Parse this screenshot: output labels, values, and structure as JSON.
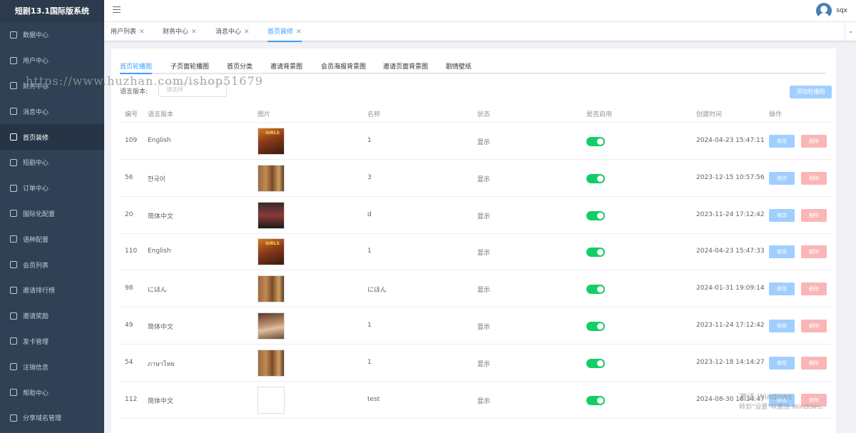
{
  "app": {
    "title": "短剧13.1国际版系统"
  },
  "sidebar": {
    "items": [
      {
        "label": "数据中心",
        "icon": "chart-icon",
        "active": false
      },
      {
        "label": "用户中心",
        "icon": "user-icon",
        "active": false
      },
      {
        "label": "财务中心",
        "icon": "wallet-icon",
        "active": false
      },
      {
        "label": "消息中心",
        "icon": "message-icon",
        "active": false
      },
      {
        "label": "首页装修",
        "icon": "cube-icon",
        "active": true
      },
      {
        "label": "短剧中心",
        "icon": "film-icon",
        "active": false
      },
      {
        "label": "订单中心",
        "icon": "order-icon",
        "active": false
      },
      {
        "label": "国际化配置",
        "icon": "globe-icon",
        "active": false
      },
      {
        "label": "语种配置",
        "icon": "language-icon",
        "active": false
      },
      {
        "label": "会员列表",
        "icon": "list-icon",
        "active": false
      },
      {
        "label": "邀请排行榜",
        "icon": "bar-chart-icon",
        "active": false
      },
      {
        "label": "邀请奖励",
        "icon": "gift-icon",
        "active": false
      },
      {
        "label": "发卡管理",
        "icon": "card-icon",
        "active": false
      },
      {
        "label": "注销信息",
        "icon": "logout-icon",
        "active": false
      },
      {
        "label": "帮助中心",
        "icon": "help-icon",
        "active": false
      },
      {
        "label": "分享域名管理",
        "icon": "share-icon",
        "active": false
      }
    ]
  },
  "header": {
    "username": "sqx"
  },
  "tags": [
    {
      "label": "用户列表",
      "active": false
    },
    {
      "label": "财务中心",
      "active": false
    },
    {
      "label": "消息中心",
      "active": false
    },
    {
      "label": "首页装修",
      "active": true
    }
  ],
  "tabs": [
    "首页轮播图",
    "子页面轮播图",
    "首页分类",
    "邀请背景图",
    "会员海报背景图",
    "邀请页面背景图",
    "剧情壁纸"
  ],
  "filter": {
    "label": "语言版本:",
    "placeholder": "请选择"
  },
  "add_button": "添加轮播图",
  "table": {
    "headers": [
      "编号",
      "语言版本",
      "图片",
      "名称",
      "状态",
      "是否启用",
      "创建时间",
      "操作"
    ],
    "edit_label": "修改",
    "delete_label": "删除",
    "rows": [
      {
        "id": "109",
        "lang": "English",
        "name": "1",
        "status": "显示",
        "created": "2024-04-23 15:47:11",
        "thumb": "t1",
        "thumb_text": "GIRLS",
        "enabled": true
      },
      {
        "id": "56",
        "lang": "한국어",
        "name": "3",
        "status": "显示",
        "created": "2023-12-15 10:57:56",
        "thumb": "t2",
        "thumb_text": "",
        "enabled": true
      },
      {
        "id": "20",
        "lang": "简体中文",
        "name": "d",
        "status": "显示",
        "created": "2023-11-24 17:12:42",
        "thumb": "t3",
        "thumb_text": "",
        "enabled": true
      },
      {
        "id": "110",
        "lang": "English",
        "name": "1",
        "status": "显示",
        "created": "2024-04-23 15:47:33",
        "thumb": "t1",
        "thumb_text": "GIRLS",
        "enabled": true
      },
      {
        "id": "98",
        "lang": "にほん",
        "name": "にほん",
        "status": "显示",
        "created": "2024-01-31 19:09:14",
        "thumb": "t2",
        "thumb_text": "",
        "enabled": true
      },
      {
        "id": "49",
        "lang": "简体中文",
        "name": "1",
        "status": "显示",
        "created": "2023-11-24 17:12:42",
        "thumb": "t4",
        "thumb_text": "",
        "enabled": true
      },
      {
        "id": "54",
        "lang": "ภาษาไทย",
        "name": "1",
        "status": "显示",
        "created": "2023-12-18 14:14:27",
        "thumb": "t2",
        "thumb_text": "",
        "enabled": true
      },
      {
        "id": "112",
        "lang": "简体中文",
        "name": "test",
        "status": "显示",
        "created": "2024-08-30 16:34:47",
        "thumb": "t5",
        "thumb_text": "",
        "enabled": true
      }
    ]
  },
  "watermark": "https://www.huzhan.com/ishop51679",
  "activation": {
    "line1": "激活 Windows",
    "line2": "转到\"设置\"以激活 Windows。"
  }
}
